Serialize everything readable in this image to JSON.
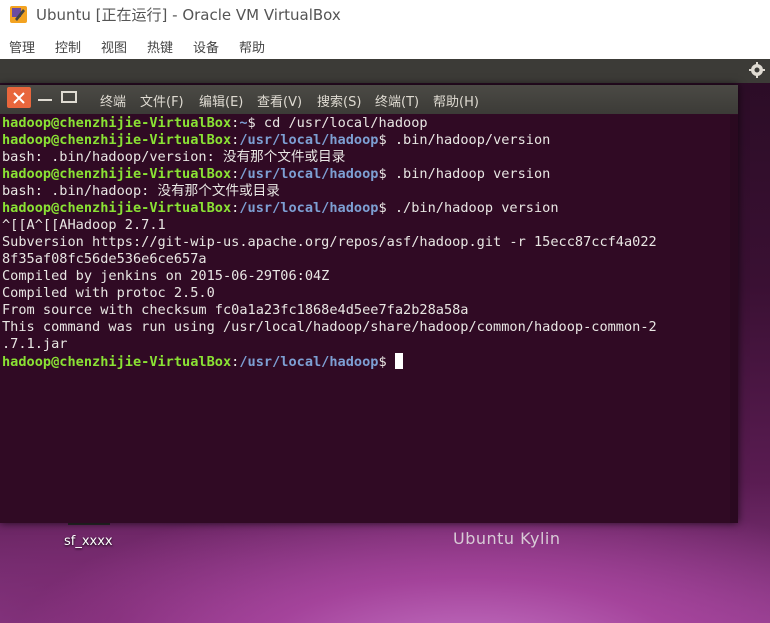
{
  "host": {
    "title": "Ubuntu [正在运行] - Oracle VM VirtualBox",
    "menu": [
      "管理",
      "控制",
      "视图",
      "热键",
      "设备",
      "帮助"
    ]
  },
  "terminal": {
    "menu": [
      "终端",
      "文件(F)",
      "编辑(E)",
      "查看(V)",
      "搜索(S)",
      "终端(T)",
      "帮助(H)"
    ],
    "user_host": "hadoop@chenzhijie-VirtualBox",
    "lines": [
      {
        "path": "~",
        "cmd": "cd /usr/local/hadoop"
      },
      {
        "path": "/usr/local/hadoop",
        "cmd": ".bin/hadoop/version"
      },
      {
        "text": "bash: .bin/hadoop/version: 没有那个文件或目录"
      },
      {
        "path": "/usr/local/hadoop",
        "cmd": ".bin/hadoop version"
      },
      {
        "text": "bash: .bin/hadoop: 没有那个文件或目录"
      },
      {
        "path": "/usr/local/hadoop",
        "cmd": "./bin/hadoop version"
      },
      {
        "text": "^[[A^[[AHadoop 2.7.1"
      },
      {
        "text": "Subversion https://git-wip-us.apache.org/repos/asf/hadoop.git -r 15ecc87ccf4a022"
      },
      {
        "text": "8f35af08fc56de536e6ce657a"
      },
      {
        "text": "Compiled by jenkins on 2015-06-29T06:04Z"
      },
      {
        "text": "Compiled with protoc 2.5.0"
      },
      {
        "text": "From source with checksum fc0a1a23fc1868e4d5ee7fa2b28a58a"
      },
      {
        "text": "This command was run using /usr/local/hadoop/share/hadoop/common/hadoop-common-2"
      },
      {
        "text": ".7.1.jar"
      },
      {
        "path": "/usr/local/hadoop",
        "cmd": "",
        "cursor": true
      }
    ]
  },
  "desktop": {
    "icon_label": "sf_xxxx",
    "watermark": "Ubuntu Kylin"
  },
  "colors": {
    "terminal_bg": "#300a24",
    "user_green": "#8ae234",
    "path_blue": "#7d9fd3",
    "close_orange": "#e8663c"
  }
}
